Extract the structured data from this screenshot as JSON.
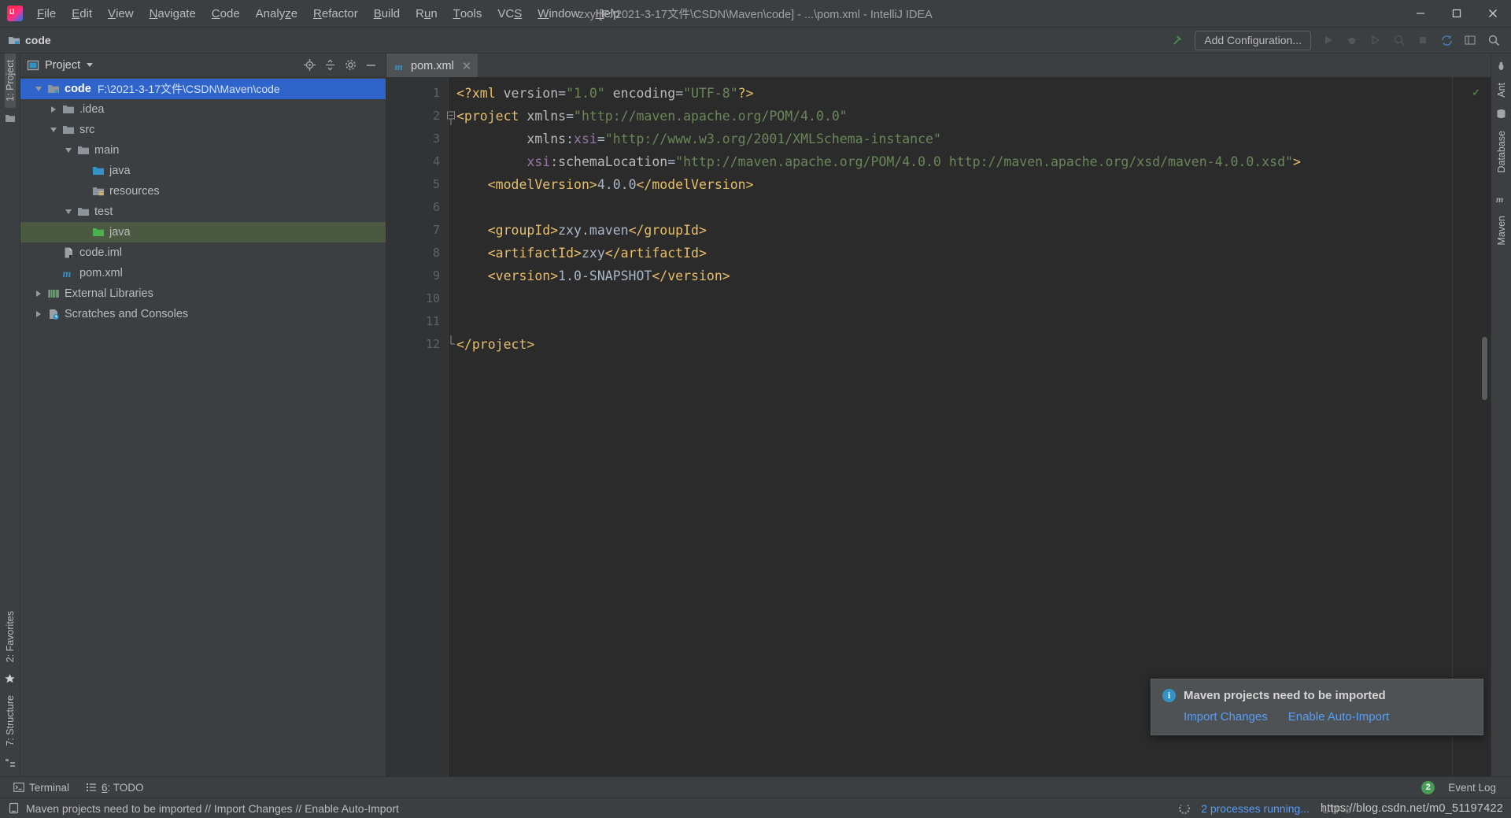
{
  "window": {
    "title": "zxy [F:\\2021-3-17文件\\CSDN\\Maven\\code] - ...\\pom.xml - IntelliJ IDEA",
    "logo_text": "IJ",
    "minimize": "–",
    "maximize": "❐",
    "close": "✕"
  },
  "menu": {
    "items": [
      {
        "label": "File",
        "mnemonic": "F"
      },
      {
        "label": "Edit",
        "mnemonic": "E"
      },
      {
        "label": "View",
        "mnemonic": "V"
      },
      {
        "label": "Navigate",
        "mnemonic": "N"
      },
      {
        "label": "Code",
        "mnemonic": "C"
      },
      {
        "label": "Analyze",
        "mnemonic": "z"
      },
      {
        "label": "Refactor",
        "mnemonic": "R"
      },
      {
        "label": "Build",
        "mnemonic": "B"
      },
      {
        "label": "Run",
        "mnemonic": "u"
      },
      {
        "label": "Tools",
        "mnemonic": "T"
      },
      {
        "label": "VCS",
        "mnemonic": "S"
      },
      {
        "label": "Window",
        "mnemonic": "W"
      },
      {
        "label": "Help",
        "mnemonic": "H"
      }
    ]
  },
  "toolbar": {
    "breadcrumb": "code",
    "breadcrumb_icon": "project-folder-icon",
    "build_icon": "hammer-build-icon",
    "add_configuration_label": "Add Configuration...",
    "icons": [
      "run-icon",
      "debug-icon",
      "run-with-coverage-icon",
      "profile-icon",
      "stop-icon",
      "git-update-icon",
      "layout-icon",
      "search-everywhere-icon"
    ]
  },
  "left_strip": {
    "tabs": [
      {
        "label": "1: Project",
        "active": true,
        "icon": "project-icon"
      },
      {
        "label": "2: Favorites",
        "active": false,
        "icon": "favorites-star-icon"
      },
      {
        "label": "7: Structure",
        "active": false,
        "icon": "structure-icon"
      }
    ]
  },
  "right_strip": {
    "tabs": [
      {
        "label": "Ant",
        "icon": "ant-icon"
      },
      {
        "label": "Database",
        "icon": "database-icon"
      },
      {
        "label": "Maven",
        "icon": "maven-icon"
      }
    ]
  },
  "project_panel": {
    "title": "Project",
    "header_icons": [
      "locate-target-icon",
      "collapse-all-icon",
      "gear-settings-icon",
      "hide-minimize-icon"
    ],
    "tree": [
      {
        "label": "code",
        "path": "F:\\2021-3-17文件\\CSDN\\Maven\\code",
        "depth": 0,
        "arrow": "down",
        "icon": "module-folder-icon",
        "state": "selected-blue",
        "bold": true
      },
      {
        "label": ".idea",
        "path": "",
        "depth": 1,
        "arrow": "right",
        "icon": "folder-icon",
        "state": "none",
        "bold": false
      },
      {
        "label": "src",
        "path": "",
        "depth": 1,
        "arrow": "down",
        "icon": "folder-icon",
        "state": "none",
        "bold": false
      },
      {
        "label": "main",
        "path": "",
        "depth": 2,
        "arrow": "down",
        "icon": "folder-icon",
        "state": "none",
        "bold": false
      },
      {
        "label": "java",
        "path": "",
        "depth": 3,
        "arrow": "none",
        "icon": "source-folder-blue-icon",
        "state": "none",
        "bold": false
      },
      {
        "label": "resources",
        "path": "",
        "depth": 3,
        "arrow": "none",
        "icon": "resources-folder-icon",
        "state": "none",
        "bold": false
      },
      {
        "label": "test",
        "path": "",
        "depth": 2,
        "arrow": "down",
        "icon": "folder-icon",
        "state": "none",
        "bold": false
      },
      {
        "label": "java",
        "path": "",
        "depth": 3,
        "arrow": "none",
        "icon": "test-source-folder-green-icon",
        "state": "selected-green",
        "bold": false
      },
      {
        "label": "code.iml",
        "path": "",
        "depth": 1,
        "arrow": "none",
        "icon": "iml-file-icon",
        "state": "none",
        "bold": false
      },
      {
        "label": "pom.xml",
        "path": "",
        "depth": 1,
        "arrow": "none",
        "icon": "maven-pom-icon",
        "state": "none",
        "bold": false
      },
      {
        "label": "External Libraries",
        "path": "",
        "depth": 0,
        "arrow": "right",
        "icon": "libraries-icon",
        "state": "none",
        "bold": false
      },
      {
        "label": "Scratches and Consoles",
        "path": "",
        "depth": 0,
        "arrow": "right",
        "icon": "scratches-icon",
        "state": "none",
        "bold": false
      }
    ]
  },
  "editor": {
    "tabs": [
      {
        "label": "pom.xml",
        "icon": "maven-pom-icon",
        "active": true,
        "close": "✕"
      }
    ],
    "inspection_status": "✓",
    "lines": [
      {
        "number": "1",
        "fold": "none",
        "tokens": [
          {
            "t": "<?xml ",
            "c": "t-pi"
          },
          {
            "t": "version",
            "c": "t-attr"
          },
          {
            "t": "=",
            "c": "t-eq"
          },
          {
            "t": "\"1.0\"",
            "c": "t-str"
          },
          {
            "t": " ",
            "c": "t-txt"
          },
          {
            "t": "encoding",
            "c": "t-attr"
          },
          {
            "t": "=",
            "c": "t-eq"
          },
          {
            "t": "\"UTF-8\"",
            "c": "t-str"
          },
          {
            "t": "?>",
            "c": "t-pi"
          }
        ]
      },
      {
        "number": "2",
        "fold": "start",
        "tokens": [
          {
            "t": "<project",
            "c": "t-tag"
          },
          {
            "t": " ",
            "c": "t-txt"
          },
          {
            "t": "xmlns",
            "c": "t-attr"
          },
          {
            "t": "=",
            "c": "t-eq"
          },
          {
            "t": "\"http://maven.apache.org/POM/4.0.0\"",
            "c": "t-str"
          }
        ]
      },
      {
        "number": "3",
        "fold": "none",
        "tokens": [
          {
            "t": "         ",
            "c": "t-txt"
          },
          {
            "t": "xmlns",
            "c": "t-attr"
          },
          {
            "t": ":",
            "c": "t-eq"
          },
          {
            "t": "xsi",
            "c": "t-ns"
          },
          {
            "t": "=",
            "c": "t-eq"
          },
          {
            "t": "\"http://www.w3.org/2001/XMLSchema-instance\"",
            "c": "t-str"
          }
        ]
      },
      {
        "number": "4",
        "fold": "none",
        "tokens": [
          {
            "t": "         ",
            "c": "t-txt"
          },
          {
            "t": "xsi",
            "c": "t-ns"
          },
          {
            "t": ":",
            "c": "t-eq"
          },
          {
            "t": "schemaLocation",
            "c": "t-attr"
          },
          {
            "t": "=",
            "c": "t-eq"
          },
          {
            "t": "\"http://maven.apache.org/POM/4.0.0 http://maven.apache.org/xsd/maven-4.0.0.xsd\"",
            "c": "t-str"
          },
          {
            "t": ">",
            "c": "t-tag"
          }
        ]
      },
      {
        "number": "5",
        "fold": "none",
        "tokens": [
          {
            "t": "    ",
            "c": "t-txt"
          },
          {
            "t": "<modelVersion>",
            "c": "t-tag"
          },
          {
            "t": "4.0.0",
            "c": "t-txt"
          },
          {
            "t": "</modelVersion>",
            "c": "t-tag"
          }
        ]
      },
      {
        "number": "6",
        "fold": "none",
        "tokens": []
      },
      {
        "number": "7",
        "fold": "none",
        "tokens": [
          {
            "t": "    ",
            "c": "t-txt"
          },
          {
            "t": "<groupId>",
            "c": "t-tag"
          },
          {
            "t": "zxy.maven",
            "c": "t-txt"
          },
          {
            "t": "</groupId>",
            "c": "t-tag"
          }
        ]
      },
      {
        "number": "8",
        "fold": "none",
        "tokens": [
          {
            "t": "    ",
            "c": "t-txt"
          },
          {
            "t": "<artifactId>",
            "c": "t-tag"
          },
          {
            "t": "zxy",
            "c": "t-txt"
          },
          {
            "t": "</artifactId>",
            "c": "t-tag"
          }
        ]
      },
      {
        "number": "9",
        "fold": "none",
        "tokens": [
          {
            "t": "    ",
            "c": "t-txt"
          },
          {
            "t": "<version>",
            "c": "t-tag"
          },
          {
            "t": "1.0-SNAPSHOT",
            "c": "t-txt"
          },
          {
            "t": "</version>",
            "c": "t-tag"
          }
        ]
      },
      {
        "number": "10",
        "fold": "none",
        "tokens": []
      },
      {
        "number": "11",
        "fold": "none",
        "tokens": []
      },
      {
        "number": "12",
        "fold": "end",
        "tokens": [
          {
            "t": "</project>",
            "c": "t-tag"
          }
        ]
      }
    ]
  },
  "notification": {
    "icon": "info-icon",
    "icon_glyph": "i",
    "title": "Maven projects need to be imported",
    "links": [
      "Import Changes",
      "Enable Auto-Import"
    ]
  },
  "bottom_bar": {
    "buttons": [
      {
        "label": "Terminal",
        "mnemonic": "",
        "icon": "terminal-icon"
      },
      {
        "label": "6: TODO",
        "mnemonic": "6",
        "icon": "todo-list-icon"
      }
    ],
    "event_log": {
      "label": "Event Log",
      "count": "2"
    }
  },
  "status_bar": {
    "icon": "notification-balloon-icon",
    "message": "Maven projects need to be imported // Import Changes // Enable Auto-Import",
    "processes": "2 processes running...",
    "watermark": "https://blog.csdn.net/m0_51197422",
    "encoding_hint": "UTF-8"
  },
  "colors": {
    "accent_blue": "#2f65ca",
    "link_blue": "#589df6",
    "test_green": "#4b5943",
    "panel_bg": "#3c3f41",
    "editor_bg": "#2b2b2b",
    "gutter_bg": "#313335",
    "tag_orange": "#e8bf6a",
    "string_green": "#6a8759",
    "ns_purple": "#9876aa",
    "text_gray": "#a9b7c6"
  }
}
